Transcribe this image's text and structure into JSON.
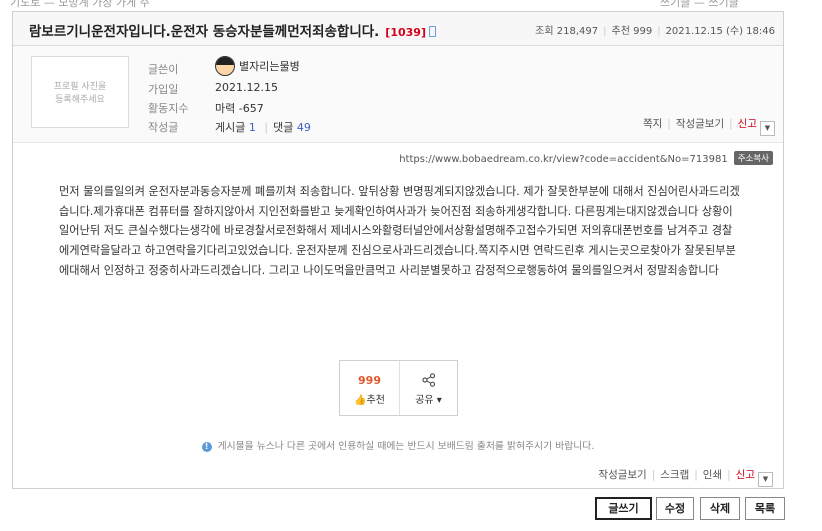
{
  "top_strip": [
    "기도로 — 모방계 가장 가게 주",
    "쓰기글 — 쓰기글"
  ],
  "post": {
    "title": "람보르기니운전자입니다.운전자 동승자분들께먼저죄송합니다.",
    "comment_count": "[1039]",
    "views_label": "조회",
    "views": "218,497",
    "likes_label": "추천",
    "likes": "999",
    "date": "2021.12.15 (수) 18:46"
  },
  "author": {
    "photo_placeholder_line1": "프로필 사진을",
    "photo_placeholder_line2": "등록해주세요",
    "labels": [
      "글쓴이",
      "가입일",
      "활동지수",
      "작성글"
    ],
    "nickname": "별자리는물병",
    "join_date": "2021.12.15",
    "activity": "마력 -657",
    "posts_label": "게시글",
    "posts_count": "1",
    "comments_label": "댓글",
    "comments_count": "49",
    "actions": [
      "쪽지",
      "작성글보기",
      "신고"
    ]
  },
  "url": {
    "text": "https://www.bobaedream.co.kr/view?code=accident&No=713981",
    "copy_label": "주소복사"
  },
  "content": "먼저 물의를일의켜 운전자분과동승자분께 폐를끼쳐 죄송합니다. 앞뒤상황 변명핑계되지않겠습니다. 제가 잘못한부분에 대해서 진심어린사과드리겠습니다.제가휴대폰 컴퓨터를 잘하지않아서 지인전화를받고 늦게확인하여사과가 늦어진점 죄송하게생각합니다. 다른핑계는대지않겠습니다 상황이일어난뒤 저도 큰실수했다는생각에 바로경찰서로전화해서 제네시스와활령터널안에서상황설명해주고접수가되면 저의휴대폰번호를 남겨주고 경찰에게연락을달라고 하고연락을기다리고있었습니다. 운전자분께 진심으로사과드리겠습니다.쪽지주시면 연락드린후 게시는곳으로찾아가 잘못된부분에대해서 인정하고 정중히사과드리겠습니다. 그리고 나이도먹을만큼먹고 사리분별못하고 감정적으로행동하여 물의를일으켜서 정말죄송합니다",
  "recommend": {
    "count": "999",
    "thumb_icon": "thumbs-up-icon",
    "label": "추천",
    "share_icon": "share-icon",
    "share_label": "공유 ▾"
  },
  "notice": {
    "icon": "info-icon",
    "text": "게시물을 뉴스나 다른 곳에서 인용하실 때에는 반드시 보배드림 출처를 밝혀주시기 바랍니다."
  },
  "bottom_actions": [
    "작성글보기",
    "스크랩",
    "인쇄",
    "신고"
  ],
  "buttons": {
    "write": "글쓰기",
    "edit": "수정",
    "delete": "삭제",
    "list": "목록"
  }
}
